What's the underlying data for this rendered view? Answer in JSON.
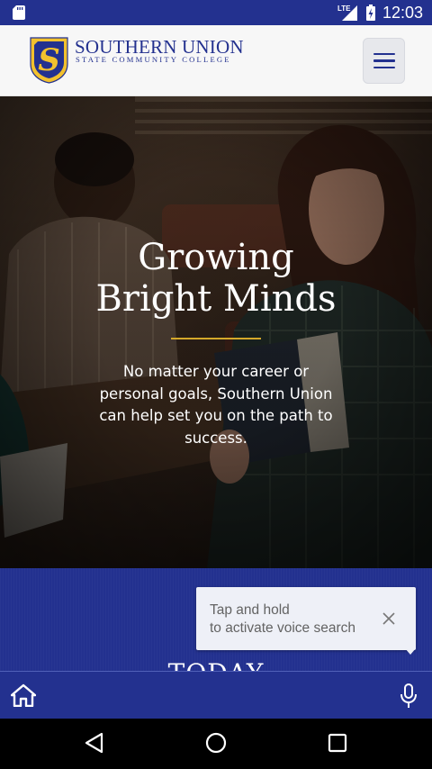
{
  "status_bar": {
    "network": "LTE",
    "time": "12:03"
  },
  "header": {
    "logo_name": "SOUTHERN UNION",
    "logo_subtitle": "STATE COMMUNITY COLLEGE",
    "logo_letter": "S",
    "menu_icon": "hamburger-menu-icon"
  },
  "hero": {
    "title_line1": "Growing",
    "title_line2": "Bright Minds",
    "text": "No matter your career or personal goals, Southern Union can help set you on the path to success."
  },
  "section": {
    "heading": "TODAY"
  },
  "tooltip": {
    "text": "Tap and hold\nto activate voice search",
    "close_icon": "close-icon"
  },
  "app_bar": {
    "home_icon": "home-icon",
    "mic_icon": "microphone-icon"
  },
  "nav_bar": {
    "back_icon": "back-icon",
    "home_icon": "home-circle-icon",
    "recents_icon": "recents-icon"
  },
  "colors": {
    "brand_blue": "#23318f",
    "brand_gold": "#d4a82a",
    "header_bg": "#f7f7f7"
  }
}
